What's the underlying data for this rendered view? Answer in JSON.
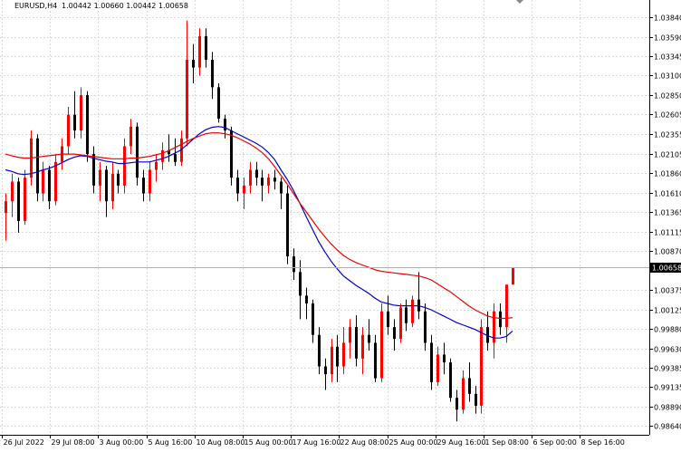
{
  "header": {
    "symbol_label": "EURUSD,H4",
    "ohlc": "1.00442 1.00660 1.00442 1.00658"
  },
  "price_tag": "1.00658",
  "colors": {
    "background": "#ffffff",
    "grid": "#d8d8d8",
    "bull": "#ff0000",
    "bear": "#000000",
    "ma_fast": "#0000cc",
    "ma_slow": "#ee0000",
    "price_line": "#b0b0b0",
    "price_tag_bg": "#000000",
    "price_tag_fg": "#ffffff"
  },
  "chart_data": {
    "type": "candlestick",
    "symbol": "EURUSD",
    "timeframe": "H4",
    "last_price": 1.00658,
    "ylim": [
      0.9853,
      1.0406
    ],
    "y_ticks": [
      "1.03840",
      "1.03590",
      "1.03345",
      "1.03100",
      "1.02850",
      "1.02605",
      "1.02355",
      "1.02105",
      "1.01860",
      "1.01610",
      "1.01365",
      "1.01115",
      "1.00870",
      "1.00375",
      "1.00125",
      "0.99880",
      "0.99630",
      "0.99385",
      "0.99135",
      "0.98890",
      "0.98640"
    ],
    "x_ticks": [
      "26 Jul 2022",
      "29 Jul 08:00",
      "3 Aug 00:00",
      "5 Aug 16:00",
      "10 Aug 08:00",
      "15 Aug 00:00",
      "17 Aug 16:00",
      "22 Aug 08:00",
      "25 Aug 00:00",
      "29 Aug 16:00",
      "1 Sep 08:00",
      "6 Sep 00:00",
      "8 Sep 16:00"
    ],
    "grid": true,
    "series": [
      {
        "kind": "candles",
        "values": [
          [
            1.0135,
            1.016,
            1.01,
            1.015
          ],
          [
            1.015,
            1.0185,
            1.013,
            1.0175
          ],
          [
            1.0175,
            1.018,
            1.011,
            1.0125
          ],
          [
            1.0125,
            1.019,
            1.012,
            1.018
          ],
          [
            1.018,
            1.024,
            1.017,
            1.023
          ],
          [
            1.023,
            1.0235,
            1.015,
            1.016
          ],
          [
            1.016,
            1.02,
            1.015,
            1.019
          ],
          [
            1.019,
            1.0195,
            1.014,
            1.015
          ],
          [
            1.015,
            1.021,
            1.0145,
            1.02
          ],
          [
            1.02,
            1.023,
            1.019,
            1.022
          ],
          [
            1.022,
            1.027,
            1.021,
            1.026
          ],
          [
            1.026,
            1.029,
            1.023,
            1.024
          ],
          [
            1.024,
            1.0295,
            1.023,
            1.0285
          ],
          [
            1.0285,
            1.029,
            1.02,
            1.021
          ],
          [
            1.021,
            1.022,
            1.016,
            1.017
          ],
          [
            1.017,
            1.02,
            1.015,
            1.019
          ],
          [
            1.019,
            1.0195,
            1.013,
            1.015
          ],
          [
            1.015,
            1.02,
            1.014,
            1.0185
          ],
          [
            1.0185,
            1.019,
            1.016,
            1.017
          ],
          [
            1.017,
            1.023,
            1.016,
            1.022
          ],
          [
            1.022,
            1.0255,
            1.021,
            1.0245
          ],
          [
            1.0245,
            1.025,
            1.017,
            1.018
          ],
          [
            1.018,
            1.019,
            1.015,
            1.016
          ],
          [
            1.016,
            1.02,
            1.015,
            1.019
          ],
          [
            1.019,
            1.021,
            1.0175,
            1.02
          ],
          [
            1.02,
            1.0225,
            1.019,
            1.0215
          ],
          [
            1.0215,
            1.0235,
            1.02,
            1.021
          ],
          [
            1.021,
            1.023,
            1.0195,
            1.02
          ],
          [
            1.02,
            1.024,
            1.0195,
            1.023
          ],
          [
            1.023,
            1.038,
            1.022,
            1.033
          ],
          [
            1.033,
            1.035,
            1.03,
            1.032
          ],
          [
            1.032,
            1.037,
            1.031,
            1.036
          ],
          [
            1.036,
            1.037,
            1.032,
            1.033
          ],
          [
            1.033,
            1.034,
            1.028,
            1.0295
          ],
          [
            1.0295,
            1.03,
            1.025,
            1.0255
          ],
          [
            1.0255,
            1.026,
            1.023,
            1.024
          ],
          [
            1.024,
            1.0245,
            1.017,
            1.018
          ],
          [
            1.018,
            1.019,
            1.015,
            1.016
          ],
          [
            1.016,
            1.018,
            1.014,
            1.017
          ],
          [
            1.017,
            1.02,
            1.016,
            1.019
          ],
          [
            1.019,
            1.02,
            1.017,
            1.018
          ],
          [
            1.018,
            1.019,
            1.015,
            1.017
          ],
          [
            1.017,
            1.0185,
            1.016,
            1.018
          ],
          [
            1.018,
            1.019,
            1.0165,
            1.0175
          ],
          [
            1.0175,
            1.018,
            1.014,
            1.016
          ],
          [
            1.016,
            1.017,
            1.007,
            1.008
          ],
          [
            1.008,
            1.009,
            1.005,
            1.006
          ],
          [
            1.006,
            1.0075,
            1.0,
            1.003
          ],
          [
            1.003,
            1.004,
            1.0,
            1.002
          ],
          [
            1.002,
            1.0025,
            0.997,
            0.998
          ],
          [
            0.998,
            0.999,
            0.993,
            0.994
          ],
          [
            0.994,
            0.995,
            0.991,
            0.993
          ],
          [
            0.993,
            0.9975,
            0.992,
            0.9965
          ],
          [
            0.9965,
            0.998,
            0.992,
            0.994
          ],
          [
            0.994,
            0.999,
            0.993,
            0.997
          ],
          [
            0.997,
            1.0,
            0.995,
            0.999
          ],
          [
            0.999,
            1.0005,
            0.994,
            0.995
          ],
          [
            0.995,
            0.999,
            0.993,
            0.998
          ],
          [
            0.998,
            1.0,
            0.996,
            0.997
          ],
          [
            0.997,
            0.998,
            0.992,
            0.9925
          ],
          [
            0.9925,
            1.002,
            0.992,
            1.001
          ],
          [
            1.001,
            1.003,
            0.998,
            0.999
          ],
          [
            0.999,
            1.0,
            0.996,
            0.9975
          ],
          [
            0.9975,
            1.002,
            0.997,
            1.0015
          ],
          [
            1.0015,
            1.0025,
            0.9985,
            0.9995
          ],
          [
            0.9995,
            1.003,
            0.999,
            1.0025
          ],
          [
            1.0025,
            1.006,
            1.0,
            1.001
          ],
          [
            1.001,
            1.002,
            0.996,
            0.997
          ],
          [
            0.997,
            0.998,
            0.991,
            0.992
          ],
          [
            0.992,
            0.9965,
            0.9915,
            0.9955
          ],
          [
            0.9955,
            0.997,
            0.993,
            0.9945
          ],
          [
            0.9945,
            0.995,
            0.9895,
            0.99
          ],
          [
            0.99,
            0.991,
            0.987,
            0.9885
          ],
          [
            0.9885,
            0.9935,
            0.988,
            0.9925
          ],
          [
            0.9925,
            0.9945,
            0.9895,
            0.9905
          ],
          [
            0.9905,
            0.9915,
            0.988,
            0.989
          ],
          [
            0.989,
            1.0,
            0.988,
            0.999
          ],
          [
            0.999,
            1.001,
            0.996,
            0.997
          ],
          [
            0.997,
            1.002,
            0.995,
            1.001
          ],
          [
            1.001,
            1.002,
            0.998,
            0.999
          ],
          [
            0.999,
            1.003,
            0.997,
            1.0044
          ],
          [
            1.0044,
            1.0066,
            1.0044,
            1.0066
          ]
        ]
      },
      {
        "kind": "ma",
        "color": "#0000cc",
        "values": [
          1.019,
          1.0188,
          1.0185,
          1.0184,
          1.0185,
          1.0187,
          1.019,
          1.0192,
          1.0195,
          1.0199,
          1.0203,
          1.0206,
          1.0208,
          1.0207,
          1.0205,
          1.0203,
          1.0201,
          1.02,
          1.0198,
          1.0198,
          1.0199,
          1.02,
          1.02,
          1.02,
          1.0202,
          1.0204,
          1.0207,
          1.0211,
          1.0215,
          1.0222,
          1.0229,
          1.0236,
          1.0241,
          1.0244,
          1.0245,
          1.0244,
          1.024,
          1.0236,
          1.0232,
          1.0228,
          1.0224,
          1.0219,
          1.0212,
          1.0203,
          1.019,
          1.0178,
          1.0164,
          1.0148,
          1.0131,
          1.0115,
          1.0099,
          1.0086,
          1.0074,
          1.0064,
          1.0055,
          1.0049,
          1.0043,
          1.0038,
          1.0033,
          1.0027,
          1.0022,
          1.002,
          1.0018,
          1.0017,
          1.0017,
          1.0017,
          1.0017,
          1.0015,
          1.0012,
          1.0008,
          1.0004,
          1.0,
          0.9996,
          0.9993,
          0.999,
          0.9987,
          0.9983,
          0.9979,
          0.9976,
          0.9976,
          0.9978,
          0.9985
        ]
      },
      {
        "kind": "ma",
        "color": "#ee0000",
        "values": [
          1.021,
          1.0208,
          1.0206,
          1.0205,
          1.0205,
          1.0206,
          1.0207,
          1.0208,
          1.0209,
          1.021,
          1.021,
          1.021,
          1.0209,
          1.0208,
          1.0207,
          1.0206,
          1.0205,
          1.0204,
          1.0204,
          1.0204,
          1.0205,
          1.0205,
          1.0206,
          1.0207,
          1.0209,
          1.0211,
          1.0214,
          1.0218,
          1.0222,
          1.0226,
          1.023,
          1.0233,
          1.0236,
          1.0237,
          1.0237,
          1.0236,
          1.0234,
          1.0231,
          1.0227,
          1.0223,
          1.0218,
          1.0212,
          1.0204,
          1.0194,
          1.0183,
          1.0172,
          1.016,
          1.0148,
          1.0137,
          1.0126,
          1.0115,
          1.0105,
          1.0096,
          1.0088,
          1.0081,
          1.0076,
          1.0072,
          1.0069,
          1.0066,
          1.0063,
          1.0061,
          1.006,
          1.0059,
          1.0058,
          1.0057,
          1.0056,
          1.0055,
          1.0053,
          1.005,
          1.0045,
          1.004,
          1.0035,
          1.0029,
          1.0023,
          1.0017,
          1.0012,
          1.0008,
          1.0004,
          1.0002,
          1.0001,
          1.0001,
          1.0002
        ]
      }
    ]
  }
}
